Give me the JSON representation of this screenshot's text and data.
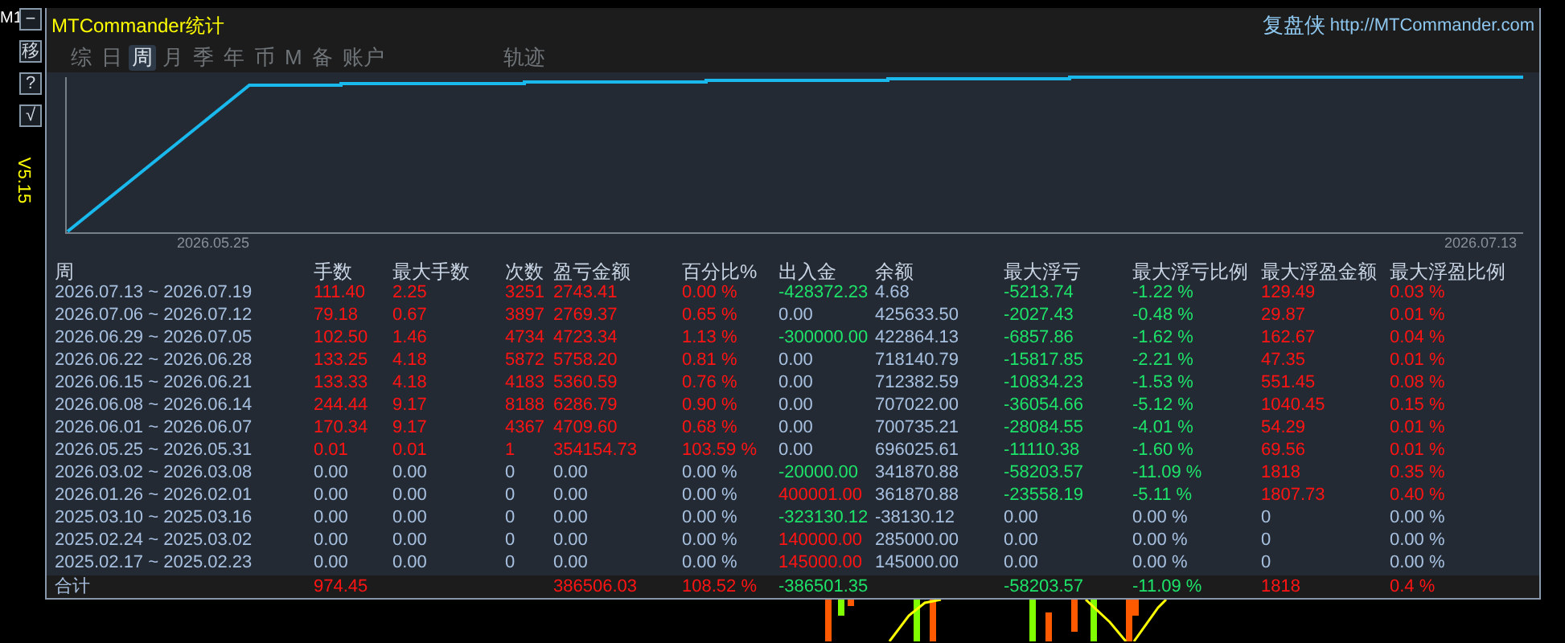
{
  "side": {
    "timeframe": "M1",
    "buttons": [
      {
        "label": "−"
      },
      {
        "label": "移"
      },
      {
        "label": "?"
      },
      {
        "label": "√"
      }
    ],
    "version": "V5.15"
  },
  "title": "MTCommander统计",
  "brand": {
    "name": "复盘侠",
    "url": "http://MTCommander.com"
  },
  "tabs": [
    {
      "label": "综",
      "selected": false
    },
    {
      "label": "日",
      "selected": false
    },
    {
      "label": "周",
      "selected": true
    },
    {
      "label": "月",
      "selected": false
    },
    {
      "label": "季",
      "selected": false
    },
    {
      "label": "年",
      "selected": false
    },
    {
      "label": "币",
      "selected": false
    },
    {
      "label": "M",
      "selected": false
    },
    {
      "label": "备",
      "selected": false
    },
    {
      "label": "账户",
      "selected": false
    },
    {
      "label": "轨迹",
      "selected": false
    }
  ],
  "chart": {
    "x_labels": [
      "2026.05.25",
      "2026.07.13"
    ]
  },
  "table": {
    "columns": [
      "周",
      "手数",
      "最大手数",
      "次数",
      "盈亏金额",
      "百分比%",
      "出入金",
      "余额",
      "最大浮亏",
      "最大浮亏比例",
      "最大浮盈金额",
      "最大浮盈比例"
    ],
    "rows": [
      {
        "cells": [
          {
            "text": "2026.07.13 ~ 2026.07.19",
            "color": "#a8c0e0"
          },
          {
            "text": "111.40",
            "color": "#ff1414"
          },
          {
            "text": "2.25",
            "color": "#ff1414"
          },
          {
            "text": "3251",
            "color": "#ff1414"
          },
          {
            "text": "2743.41",
            "color": "#ff1414"
          },
          {
            "text": "0.00 %",
            "color": "#ff1414"
          },
          {
            "text": "-428372.23",
            "color": "#1ee36a"
          },
          {
            "text": "4.68",
            "color": "#a8c0e0"
          },
          {
            "text": "-5213.74",
            "color": "#1ee36a"
          },
          {
            "text": "-1.22 %",
            "color": "#1ee36a"
          },
          {
            "text": "129.49",
            "color": "#ff1414"
          },
          {
            "text": "0.03 %",
            "color": "#ff1414"
          }
        ]
      },
      {
        "cells": [
          {
            "text": "2026.07.06 ~ 2026.07.12",
            "color": "#a8c0e0"
          },
          {
            "text": "79.18",
            "color": "#ff1414"
          },
          {
            "text": "0.67",
            "color": "#ff1414"
          },
          {
            "text": "3897",
            "color": "#ff1414"
          },
          {
            "text": "2769.37",
            "color": "#ff1414"
          },
          {
            "text": "0.65 %",
            "color": "#ff1414"
          },
          {
            "text": "0.00",
            "color": "#a8c0e0"
          },
          {
            "text": "425633.50",
            "color": "#a8c0e0"
          },
          {
            "text": "-2027.43",
            "color": "#1ee36a"
          },
          {
            "text": "-0.48 %",
            "color": "#1ee36a"
          },
          {
            "text": "29.87",
            "color": "#ff1414"
          },
          {
            "text": "0.01 %",
            "color": "#ff1414"
          }
        ]
      },
      {
        "cells": [
          {
            "text": "2026.06.29 ~ 2026.07.05",
            "color": "#a8c0e0"
          },
          {
            "text": "102.50",
            "color": "#ff1414"
          },
          {
            "text": "1.46",
            "color": "#ff1414"
          },
          {
            "text": "4734",
            "color": "#ff1414"
          },
          {
            "text": "4723.34",
            "color": "#ff1414"
          },
          {
            "text": "1.13 %",
            "color": "#ff1414"
          },
          {
            "text": "-300000.00",
            "color": "#1ee36a"
          },
          {
            "text": "422864.13",
            "color": "#a8c0e0"
          },
          {
            "text": "-6857.86",
            "color": "#1ee36a"
          },
          {
            "text": "-1.62 %",
            "color": "#1ee36a"
          },
          {
            "text": "162.67",
            "color": "#ff1414"
          },
          {
            "text": "0.04 %",
            "color": "#ff1414"
          }
        ]
      },
      {
        "cells": [
          {
            "text": "2026.06.22 ~ 2026.06.28",
            "color": "#a8c0e0"
          },
          {
            "text": "133.25",
            "color": "#ff1414"
          },
          {
            "text": "4.18",
            "color": "#ff1414"
          },
          {
            "text": "5872",
            "color": "#ff1414"
          },
          {
            "text": "5758.20",
            "color": "#ff1414"
          },
          {
            "text": "0.81 %",
            "color": "#ff1414"
          },
          {
            "text": "0.00",
            "color": "#a8c0e0"
          },
          {
            "text": "718140.79",
            "color": "#a8c0e0"
          },
          {
            "text": "-15817.85",
            "color": "#1ee36a"
          },
          {
            "text": "-2.21 %",
            "color": "#1ee36a"
          },
          {
            "text": "47.35",
            "color": "#ff1414"
          },
          {
            "text": "0.01 %",
            "color": "#ff1414"
          }
        ]
      },
      {
        "cells": [
          {
            "text": "2026.06.15 ~ 2026.06.21",
            "color": "#a8c0e0"
          },
          {
            "text": "133.33",
            "color": "#ff1414"
          },
          {
            "text": "4.18",
            "color": "#ff1414"
          },
          {
            "text": "4183",
            "color": "#ff1414"
          },
          {
            "text": "5360.59",
            "color": "#ff1414"
          },
          {
            "text": "0.76 %",
            "color": "#ff1414"
          },
          {
            "text": "0.00",
            "color": "#a8c0e0"
          },
          {
            "text": "712382.59",
            "color": "#a8c0e0"
          },
          {
            "text": "-10834.23",
            "color": "#1ee36a"
          },
          {
            "text": "-1.53 %",
            "color": "#1ee36a"
          },
          {
            "text": "551.45",
            "color": "#ff1414"
          },
          {
            "text": "0.08 %",
            "color": "#ff1414"
          }
        ]
      },
      {
        "cells": [
          {
            "text": "2026.06.08 ~ 2026.06.14",
            "color": "#a8c0e0"
          },
          {
            "text": "244.44",
            "color": "#ff1414"
          },
          {
            "text": "9.17",
            "color": "#ff1414"
          },
          {
            "text": "8188",
            "color": "#ff1414"
          },
          {
            "text": "6286.79",
            "color": "#ff1414"
          },
          {
            "text": "0.90 %",
            "color": "#ff1414"
          },
          {
            "text": "0.00",
            "color": "#a8c0e0"
          },
          {
            "text": "707022.00",
            "color": "#a8c0e0"
          },
          {
            "text": "-36054.66",
            "color": "#1ee36a"
          },
          {
            "text": "-5.12 %",
            "color": "#1ee36a"
          },
          {
            "text": "1040.45",
            "color": "#ff1414"
          },
          {
            "text": "0.15 %",
            "color": "#ff1414"
          }
        ]
      },
      {
        "cells": [
          {
            "text": "2026.06.01 ~ 2026.06.07",
            "color": "#a8c0e0"
          },
          {
            "text": "170.34",
            "color": "#ff1414"
          },
          {
            "text": "9.17",
            "color": "#ff1414"
          },
          {
            "text": "4367",
            "color": "#ff1414"
          },
          {
            "text": "4709.60",
            "color": "#ff1414"
          },
          {
            "text": "0.68 %",
            "color": "#ff1414"
          },
          {
            "text": "0.00",
            "color": "#a8c0e0"
          },
          {
            "text": "700735.21",
            "color": "#a8c0e0"
          },
          {
            "text": "-28084.55",
            "color": "#1ee36a"
          },
          {
            "text": "-4.01 %",
            "color": "#1ee36a"
          },
          {
            "text": "54.29",
            "color": "#ff1414"
          },
          {
            "text": "0.01 %",
            "color": "#ff1414"
          }
        ]
      },
      {
        "cells": [
          {
            "text": "2026.05.25 ~ 2026.05.31",
            "color": "#a8c0e0"
          },
          {
            "text": "0.01",
            "color": "#ff1414"
          },
          {
            "text": "0.01",
            "color": "#ff1414"
          },
          {
            "text": "1",
            "color": "#ff1414"
          },
          {
            "text": "354154.73",
            "color": "#ff1414"
          },
          {
            "text": "103.59 %",
            "color": "#ff1414"
          },
          {
            "text": "0.00",
            "color": "#a8c0e0"
          },
          {
            "text": "696025.61",
            "color": "#a8c0e0"
          },
          {
            "text": "-11110.38",
            "color": "#1ee36a"
          },
          {
            "text": "-1.60 %",
            "color": "#1ee36a"
          },
          {
            "text": "69.56",
            "color": "#ff1414"
          },
          {
            "text": "0.01 %",
            "color": "#ff1414"
          }
        ]
      },
      {
        "cells": [
          {
            "text": "2026.03.02 ~ 2026.03.08",
            "color": "#a8c0e0"
          },
          {
            "text": "0.00",
            "color": "#a8c0e0"
          },
          {
            "text": "0.00",
            "color": "#a8c0e0"
          },
          {
            "text": "0",
            "color": "#a8c0e0"
          },
          {
            "text": "0.00",
            "color": "#a8c0e0"
          },
          {
            "text": "0.00 %",
            "color": "#a8c0e0"
          },
          {
            "text": "-20000.00",
            "color": "#1ee36a"
          },
          {
            "text": "341870.88",
            "color": "#a8c0e0"
          },
          {
            "text": "-58203.57",
            "color": "#1ee36a"
          },
          {
            "text": "-11.09 %",
            "color": "#1ee36a"
          },
          {
            "text": "1818",
            "color": "#ff1414"
          },
          {
            "text": "0.35 %",
            "color": "#ff1414"
          }
        ]
      },
      {
        "cells": [
          {
            "text": "2026.01.26 ~ 2026.02.01",
            "color": "#a8c0e0"
          },
          {
            "text": "0.00",
            "color": "#a8c0e0"
          },
          {
            "text": "0.00",
            "color": "#a8c0e0"
          },
          {
            "text": "0",
            "color": "#a8c0e0"
          },
          {
            "text": "0.00",
            "color": "#a8c0e0"
          },
          {
            "text": "0.00 %",
            "color": "#a8c0e0"
          },
          {
            "text": "400001.00",
            "color": "#ff1414"
          },
          {
            "text": "361870.88",
            "color": "#a8c0e0"
          },
          {
            "text": "-23558.19",
            "color": "#1ee36a"
          },
          {
            "text": "-5.11 %",
            "color": "#1ee36a"
          },
          {
            "text": "1807.73",
            "color": "#ff1414"
          },
          {
            "text": "0.40 %",
            "color": "#ff1414"
          }
        ]
      },
      {
        "cells": [
          {
            "text": "2025.03.10 ~ 2025.03.16",
            "color": "#a8c0e0"
          },
          {
            "text": "0.00",
            "color": "#a8c0e0"
          },
          {
            "text": "0.00",
            "color": "#a8c0e0"
          },
          {
            "text": "0",
            "color": "#a8c0e0"
          },
          {
            "text": "0.00",
            "color": "#a8c0e0"
          },
          {
            "text": "0.00 %",
            "color": "#a8c0e0"
          },
          {
            "text": "-323130.12",
            "color": "#1ee36a"
          },
          {
            "text": "-38130.12",
            "color": "#a8c0e0"
          },
          {
            "text": "0.00",
            "color": "#a8c0e0"
          },
          {
            "text": "0.00 %",
            "color": "#a8c0e0"
          },
          {
            "text": "0",
            "color": "#a8c0e0"
          },
          {
            "text": "0.00 %",
            "color": "#a8c0e0"
          }
        ]
      },
      {
        "cells": [
          {
            "text": "2025.02.24 ~ 2025.03.02",
            "color": "#a8c0e0"
          },
          {
            "text": "0.00",
            "color": "#a8c0e0"
          },
          {
            "text": "0.00",
            "color": "#a8c0e0"
          },
          {
            "text": "0",
            "color": "#a8c0e0"
          },
          {
            "text": "0.00",
            "color": "#a8c0e0"
          },
          {
            "text": "0.00 %",
            "color": "#a8c0e0"
          },
          {
            "text": "140000.00",
            "color": "#ff1414"
          },
          {
            "text": "285000.00",
            "color": "#a8c0e0"
          },
          {
            "text": "0.00",
            "color": "#a8c0e0"
          },
          {
            "text": "0.00 %",
            "color": "#a8c0e0"
          },
          {
            "text": "0",
            "color": "#a8c0e0"
          },
          {
            "text": "0.00 %",
            "color": "#a8c0e0"
          }
        ]
      },
      {
        "cells": [
          {
            "text": "2025.02.17 ~ 2025.02.23",
            "color": "#a8c0e0"
          },
          {
            "text": "0.00",
            "color": "#a8c0e0"
          },
          {
            "text": "0.00",
            "color": "#a8c0e0"
          },
          {
            "text": "0",
            "color": "#a8c0e0"
          },
          {
            "text": "0.00",
            "color": "#a8c0e0"
          },
          {
            "text": "0.00 %",
            "color": "#a8c0e0"
          },
          {
            "text": "145000.00",
            "color": "#ff1414"
          },
          {
            "text": "145000.00",
            "color": "#a8c0e0"
          },
          {
            "text": "0.00",
            "color": "#a8c0e0"
          },
          {
            "text": "0.00 %",
            "color": "#a8c0e0"
          },
          {
            "text": "0",
            "color": "#a8c0e0"
          },
          {
            "text": "0.00 %",
            "color": "#a8c0e0"
          }
        ]
      }
    ],
    "footer": {
      "cells": [
        {
          "text": "合计",
          "color": "#a8c0e0"
        },
        {
          "text": "974.45",
          "color": "#ff1414"
        },
        null,
        null,
        {
          "text": "386506.03",
          "color": "#ff1414"
        },
        {
          "text": "108.52 %",
          "color": "#ff1414"
        },
        {
          "text": "-386501.35",
          "color": "#1ee36a"
        },
        null,
        {
          "text": "-58203.57",
          "color": "#1ee36a"
        },
        {
          "text": "-11.09 %",
          "color": "#1ee36a"
        },
        {
          "text": "1818",
          "color": "#ff1414"
        },
        {
          "text": "0.4 %",
          "color": "#ff1414"
        }
      ]
    }
  }
}
